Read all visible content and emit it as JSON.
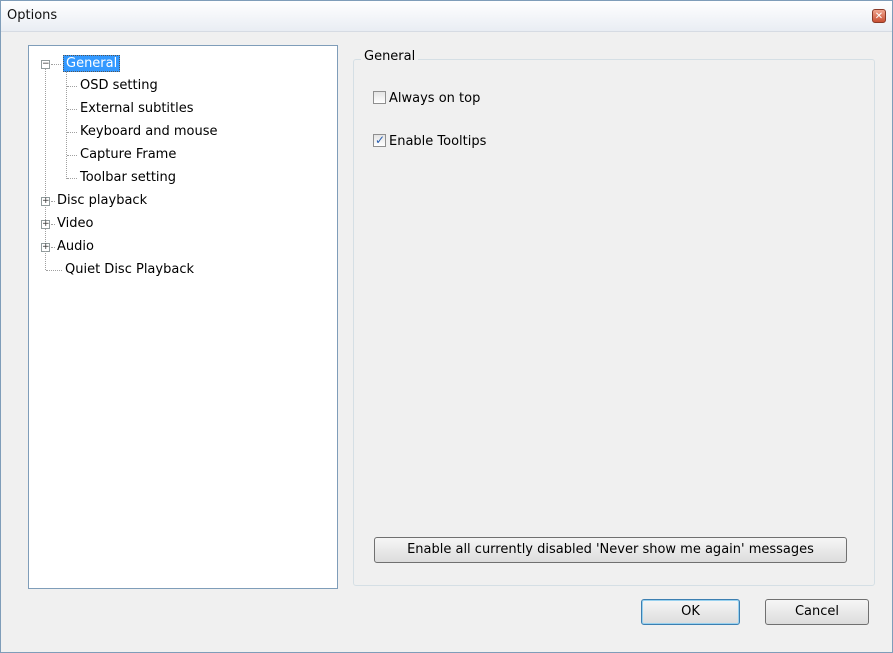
{
  "window": {
    "title": "Options",
    "close_icon": "close-icon"
  },
  "tree": {
    "general": {
      "label": "General",
      "expanded": true
    },
    "general_children": [
      "OSD setting",
      "External subtitles",
      "Keyboard and mouse",
      "Capture Frame",
      "Toolbar setting"
    ],
    "disc_playback": {
      "label": "Disc playback",
      "expanded": false
    },
    "video": {
      "label": "Video",
      "expanded": false
    },
    "audio": {
      "label": "Audio",
      "expanded": false
    },
    "quiet_disc_playback": {
      "label": "Quiet Disc Playback"
    }
  },
  "general_panel": {
    "group_label": "General",
    "always_on_top": {
      "label": "Always on top",
      "checked": false
    },
    "enable_tooltips": {
      "label": "Enable Tooltips",
      "checked": true
    },
    "reset_messages_button": "Enable all currently disabled 'Never show me again' messages"
  },
  "footer": {
    "ok_label": "OK",
    "cancel_label": "Cancel"
  },
  "colors": {
    "selection": "#3399ff",
    "accent_border": "#3c7fb1"
  }
}
